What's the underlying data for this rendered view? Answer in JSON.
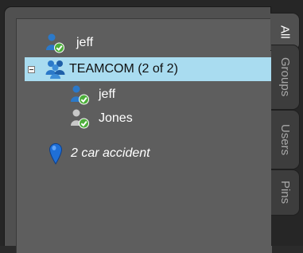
{
  "tree": {
    "items": [
      {
        "label": "jeff",
        "type": "user",
        "italic": false
      },
      {
        "label": "TEAMCOM (2 of 2)",
        "type": "group",
        "selected": true
      },
      {
        "label": "jeff",
        "type": "user",
        "italic": false
      },
      {
        "label": "Jones",
        "type": "user-grey",
        "italic": false
      },
      {
        "label": "2 car accident",
        "type": "pin",
        "italic": true
      }
    ]
  },
  "tabs": [
    {
      "label": "All",
      "active": true
    },
    {
      "label": "Groups",
      "active": false
    },
    {
      "label": "Users",
      "active": false
    },
    {
      "label": "Pins",
      "active": false
    }
  ],
  "colors": {
    "selection": "#a9dcf0",
    "user_blue": "#2b79c9",
    "status_green": "#4cae3a",
    "pin_blue": "#1f6fd6"
  }
}
